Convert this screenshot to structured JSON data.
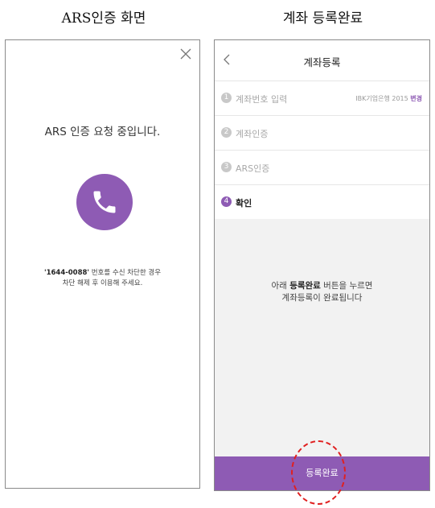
{
  "captions": {
    "left": "ARS인증 화면",
    "right": "계좌 등록완료"
  },
  "ars_screen": {
    "message": "ARS 인증 요청 중입니다.",
    "notice_number": "'1644-0088'",
    "notice_line1_rest": " 번호를 수신 차단한 경우",
    "notice_line2": "차단 해제 후 이용해 주세요.",
    "icons": [
      "close-icon",
      "phone-icon"
    ],
    "accent_color": "#8e5bb4"
  },
  "registration_screen": {
    "title": "계좌등록",
    "steps": [
      {
        "num": "1",
        "label": "계좌번호 입력",
        "active": false
      },
      {
        "num": "2",
        "label": "계좌인증",
        "active": false
      },
      {
        "num": "3",
        "label": "ARS인증",
        "active": false
      },
      {
        "num": "4",
        "label": "확인",
        "active": true
      }
    ],
    "bank_name": "IBK기업은행 2015",
    "bank_change": "변경",
    "guide_line1_pre": "아래 ",
    "guide_line1_bold": "등록완료",
    "guide_line1_post": " 버튼을 누르면",
    "guide_line2": "계좌등록이 완료됩니다",
    "submit_label": "등록완료",
    "icons": [
      "back-icon"
    ],
    "accent_color": "#8e5bb4",
    "highlight_color": "#e02020"
  }
}
